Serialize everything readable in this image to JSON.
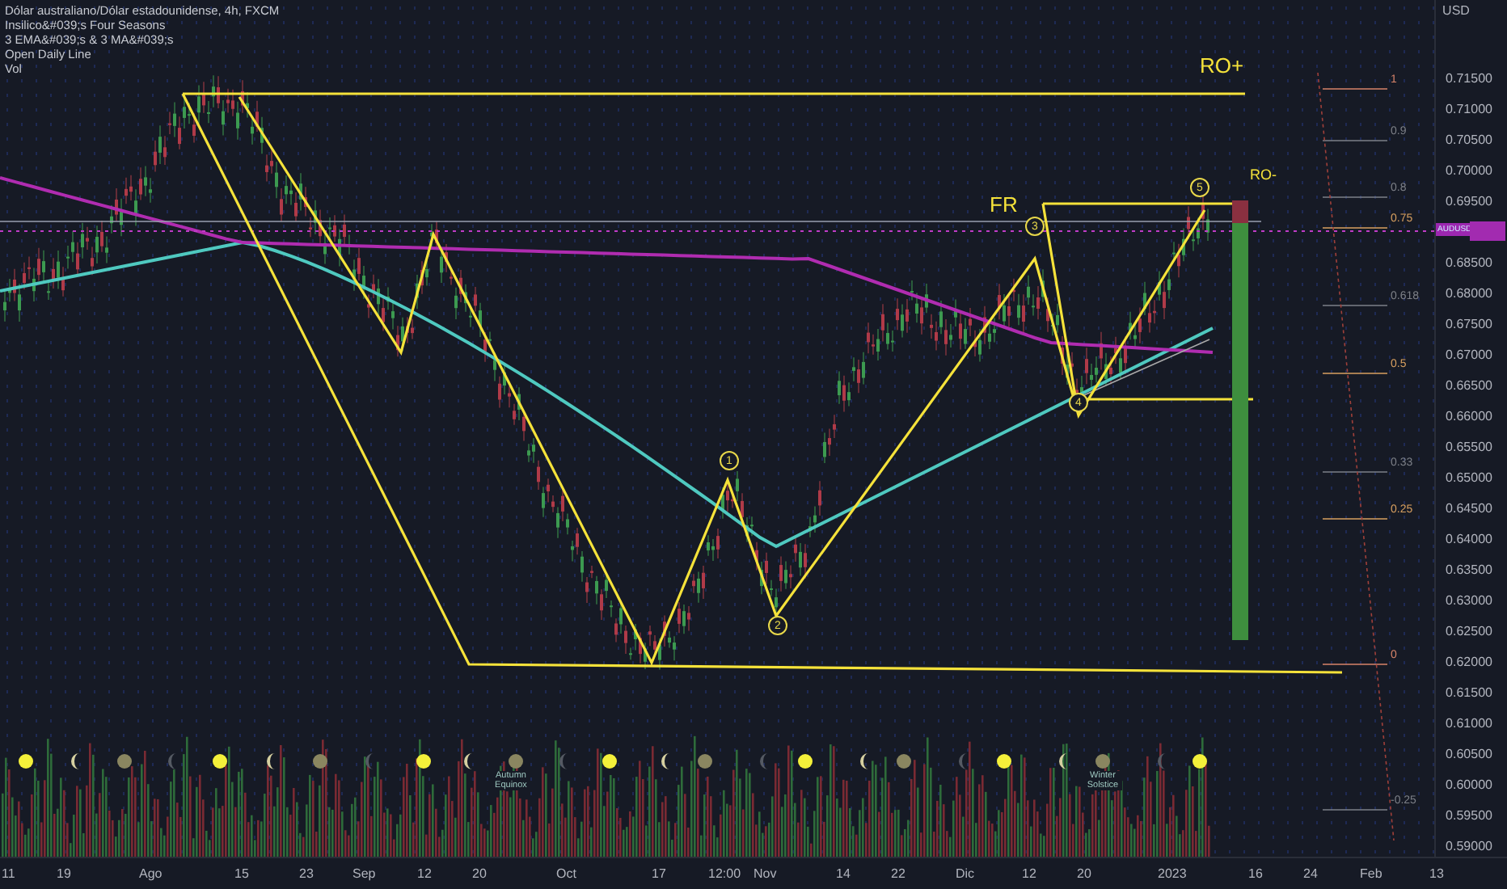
{
  "legend": [
    "Dólar australiano/Dólar estadounidense, 4h, FXCM",
    "Insilico&#039;s Four Seasons",
    "3 EMA&#039;s & 3 MA&#039;s",
    "Open Daily Line",
    "Vol"
  ],
  "currency": "USD",
  "price_axis": [
    "0.71500",
    "0.71000",
    "0.70500",
    "0.70000",
    "0.69500",
    "0.68500",
    "0.68000",
    "0.67500",
    "0.67000",
    "0.66500",
    "0.66000",
    "0.65500",
    "0.65000",
    "0.64500",
    "0.64000",
    "0.63500",
    "0.63000",
    "0.62500",
    "0.62000",
    "0.61500",
    "0.61000",
    "0.60500",
    "0.60000",
    "0.59500",
    "0.59000"
  ],
  "symbol_tag": "AUDUSD",
  "time_axis": [
    "11",
    "19",
    "Ago",
    "15",
    "23",
    "Sep",
    "12",
    "20",
    "Oct",
    "17",
    "12:00",
    "Nov",
    "14",
    "22",
    "Dic",
    "12",
    "20",
    "2023",
    "16",
    "24",
    "Feb",
    "13"
  ],
  "annotations": [
    {
      "kind": "label",
      "text": "RO+"
    },
    {
      "kind": "label",
      "text": "RO-"
    },
    {
      "kind": "label",
      "text": "FR"
    },
    {
      "kind": "wave",
      "text": "1"
    },
    {
      "kind": "wave",
      "text": "2"
    },
    {
      "kind": "wave",
      "text": "3"
    },
    {
      "kind": "wave",
      "text": "4"
    },
    {
      "kind": "wave",
      "text": "5"
    }
  ],
  "seasons": [
    "Autumn Equinox",
    "Winter Solstice"
  ],
  "fib_levels": [
    {
      "text": "1",
      "color": "#d8846a"
    },
    {
      "text": "0.9",
      "color": "#7d8088"
    },
    {
      "text": "0.8",
      "color": "#7d8088"
    },
    {
      "text": "0.75",
      "color": "#d8a060"
    },
    {
      "text": "0.618",
      "color": "#7d8088"
    },
    {
      "text": "0.5",
      "color": "#d8a060"
    },
    {
      "text": "0.33",
      "color": "#7d8088"
    },
    {
      "text": "0.25",
      "color": "#d8a060"
    },
    {
      "text": "0",
      "color": "#d8846a"
    },
    {
      "text": "-0.25",
      "color": "#7d8088"
    }
  ]
}
